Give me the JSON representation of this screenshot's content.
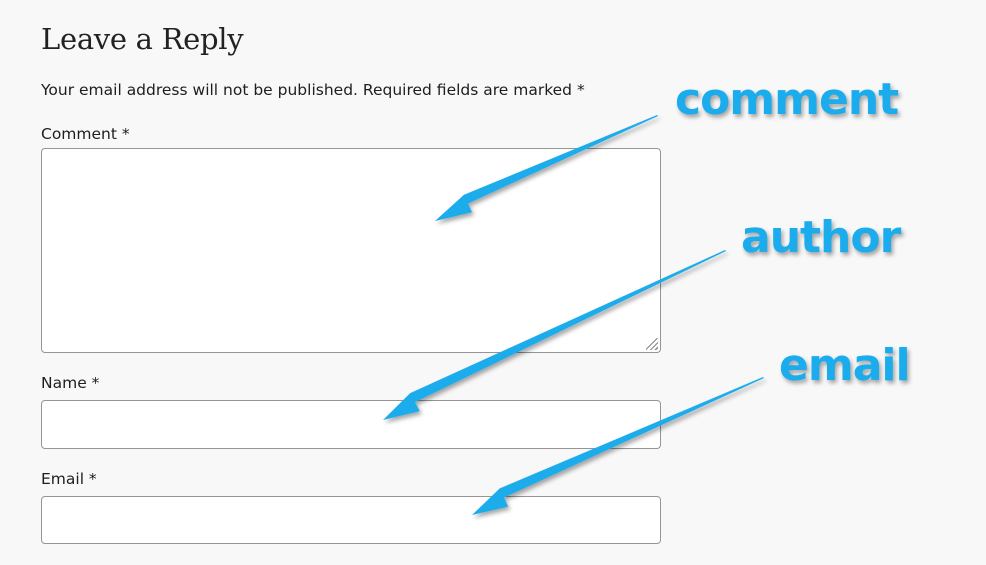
{
  "reply": {
    "title": "Leave a Reply",
    "notes": "Your email address will not be published. Required fields are marked *"
  },
  "form": {
    "comment_label": "Comment *",
    "comment_value": "",
    "name_label": "Name *",
    "name_value": "",
    "email_label": "Email *",
    "email_value": ""
  },
  "annotations": {
    "comment": "comment",
    "author": "author",
    "email": "email",
    "color": "#1aacec"
  },
  "colors": {
    "page_background": "#f8f8f8",
    "field_border": "#959595",
    "field_background": "#ffffff"
  }
}
